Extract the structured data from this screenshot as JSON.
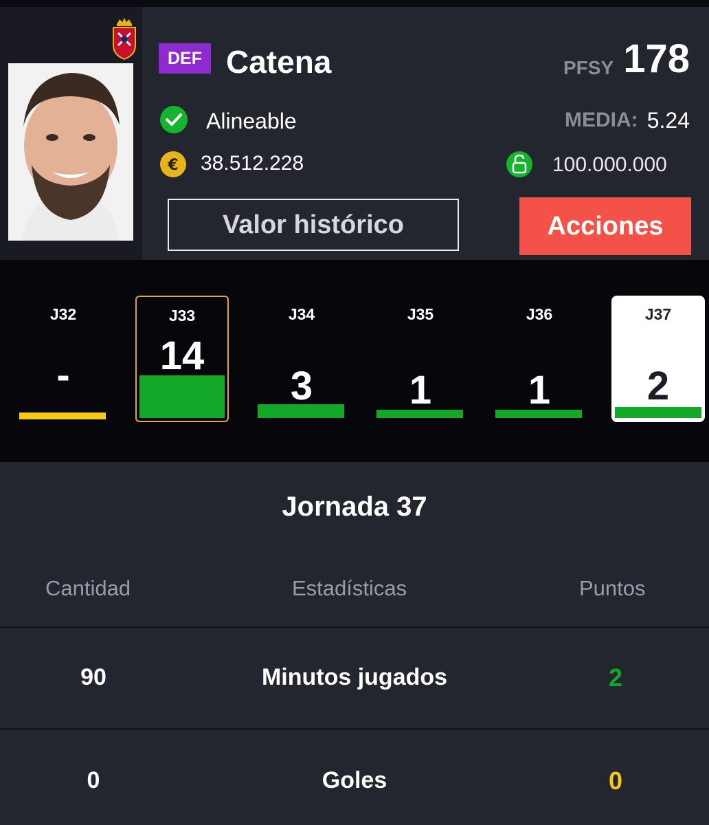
{
  "player": {
    "position": "DEF",
    "name": "Catena",
    "pfsy_label": "PFSY",
    "pfsy_value": "178",
    "status": "Alineable",
    "media_label": "MEDIA:",
    "media_value": "5.24",
    "market_value": "38.512.228",
    "clause_value": "100.000.000"
  },
  "buttons": {
    "history": "Valor histórico",
    "actions": "Acciones"
  },
  "gameweeks": [
    {
      "label": "J32",
      "points": "-",
      "bar_color": "#f6c914"
    },
    {
      "label": "J33",
      "points": "14",
      "bar_color": "#14a829",
      "selected": "highlight"
    },
    {
      "label": "J34",
      "points": "3",
      "bar_color": "#14a829"
    },
    {
      "label": "J35",
      "points": "1",
      "bar_color": "#14a829"
    },
    {
      "label": "J36",
      "points": "1",
      "bar_color": "#14a829"
    },
    {
      "label": "J37",
      "points": "2",
      "bar_color": "#14a829",
      "selected": "active"
    }
  ],
  "stats": {
    "title": "Jornada 37",
    "headers": {
      "quantity": "Cantidad",
      "stat": "Estadísticas",
      "points": "Puntos"
    },
    "rows": [
      {
        "quantity": "90",
        "stat": "Minutos jugados",
        "points": "2",
        "points_color": "#14a829"
      },
      {
        "quantity": "0",
        "stat": "Goles",
        "points": "0",
        "points_color": "#f6c914"
      }
    ]
  },
  "colors": {
    "accent_purple": "#8e2bd0",
    "action_red": "#f45248",
    "positive_green": "#14a829",
    "neutral_yellow": "#f6c914",
    "highlight_orange": "#e0a341"
  },
  "icons": {
    "status": "check-circle-icon",
    "money": "euro-coin-icon",
    "clause": "unlock-icon",
    "crest": "team-crest-icon"
  }
}
